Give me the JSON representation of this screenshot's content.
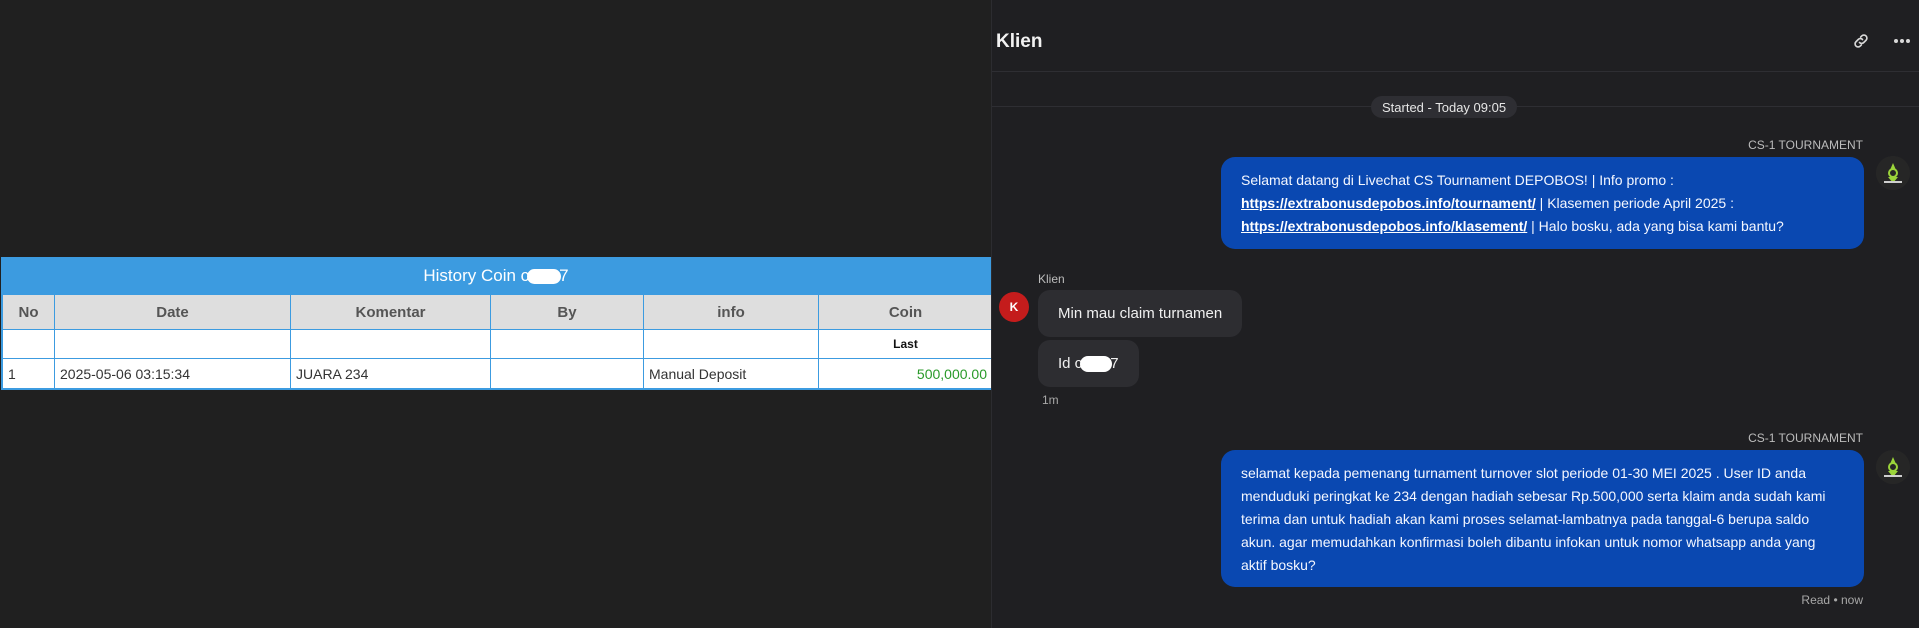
{
  "history": {
    "title_prefix": "History Coin c",
    "title_suffix": "7",
    "columns": [
      "No",
      "Date",
      "Komentar",
      "By",
      "info",
      "Coin"
    ],
    "sub_header": "Last",
    "rows": [
      {
        "no": "1",
        "date": "2025-05-06 03:15:34",
        "komentar": "JUARA 234",
        "by": "",
        "info": "Manual Deposit",
        "coin": "500,000.00"
      }
    ],
    "colors": {
      "header": "#3c9be0",
      "coin_positive": "#2a9a2a"
    }
  },
  "chat": {
    "title": "Klien",
    "header_icons": [
      "link-icon",
      "more-icon"
    ],
    "started": "Started - Today 09:05",
    "messages": [
      {
        "sender": "CS-1 TOURNAMENT",
        "line1": "Selamat datang di Livechat CS Tournament DEPOBOS! | Info promo :",
        "link1": "https://extrabonusdepobos.info/tournament/",
        "mid1": " | Klasemen periode April 2025 :",
        "link2": "https://extrabonusdepobos.info/klasement/",
        "tail": " | Halo bosku, ada yang bisa kami bantu?"
      },
      {
        "sender": "Klien",
        "avatar_letter": "K",
        "text": "Min mau claim turnamen"
      },
      {
        "text_prefix": "Id c",
        "text_suffix": "7",
        "time": "1m"
      },
      {
        "sender": "CS-1 TOURNAMENT",
        "text": "selamat kepada pemenang turnament turnover slot periode 01-30 MEI 2025 . User ID anda menduduki peringkat ke 234 dengan hadiah sebesar Rp.500,000 serta klaim anda sudah kami terima dan untuk hadiah akan kami proses selamat-lambatnya pada tanggal-6 berupa saldo akun. agar memudahkan konfirmasi boleh dibantu infokan untuk nomor whatsapp anda yang aktif bosku?",
        "status": "Read • now"
      }
    ],
    "colors": {
      "outgoing": "#0a48b1",
      "incoming": "#2d2d31",
      "avatar_k": "#c41c1c"
    }
  }
}
